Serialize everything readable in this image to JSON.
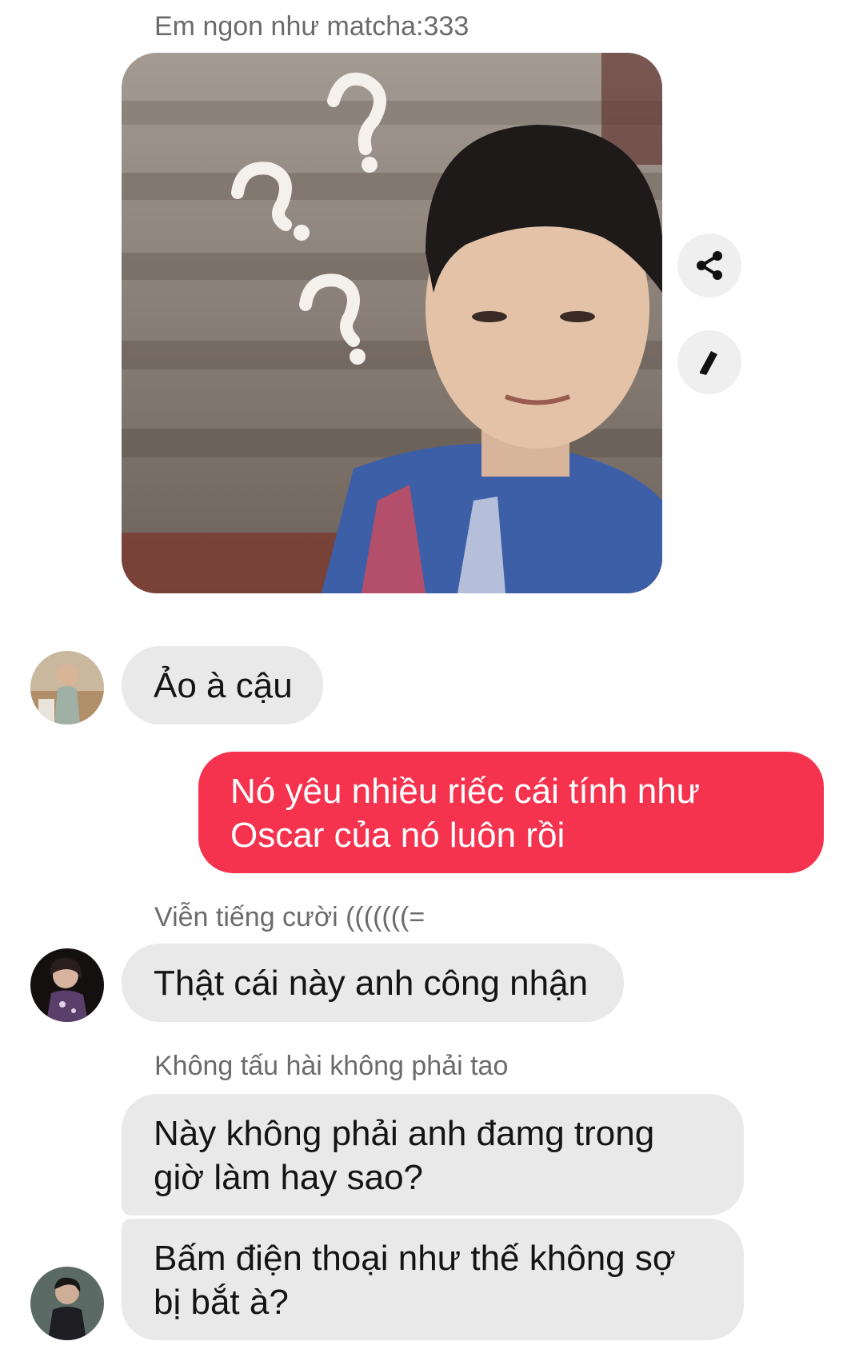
{
  "conversation": {
    "group_1": {
      "sender_name": "Em ngon như matcha:333",
      "photo_alt": "image-message",
      "actions": {
        "share_icon": "share-icon",
        "edit_icon": "pencil-icon"
      }
    },
    "group_2": {
      "message": "Ảo à cậu"
    },
    "my_message": {
      "line_1": "Nó yêu nhiều riếc cái tính như",
      "line_2": "Oscar của nó luôn rồi"
    },
    "group_3": {
      "sender_name": "Viễn tiếng cười (((((((=",
      "message": "Thật cái này anh công nhận"
    },
    "group_4": {
      "sender_name": "Không tấu hài không phải tao",
      "message_1_line_1": "Này không phải anh đamg trong",
      "message_1_line_2": "giờ làm hay sao?",
      "message_2_line_1": "Bấm điện thoại như thế không sợ",
      "message_2_line_2": "bị bắt à?"
    }
  },
  "colors": {
    "incoming_bubble": "#e9e9e9",
    "outgoing_bubble": "#f5334f",
    "sender_name_text": "#6b6b6b"
  }
}
